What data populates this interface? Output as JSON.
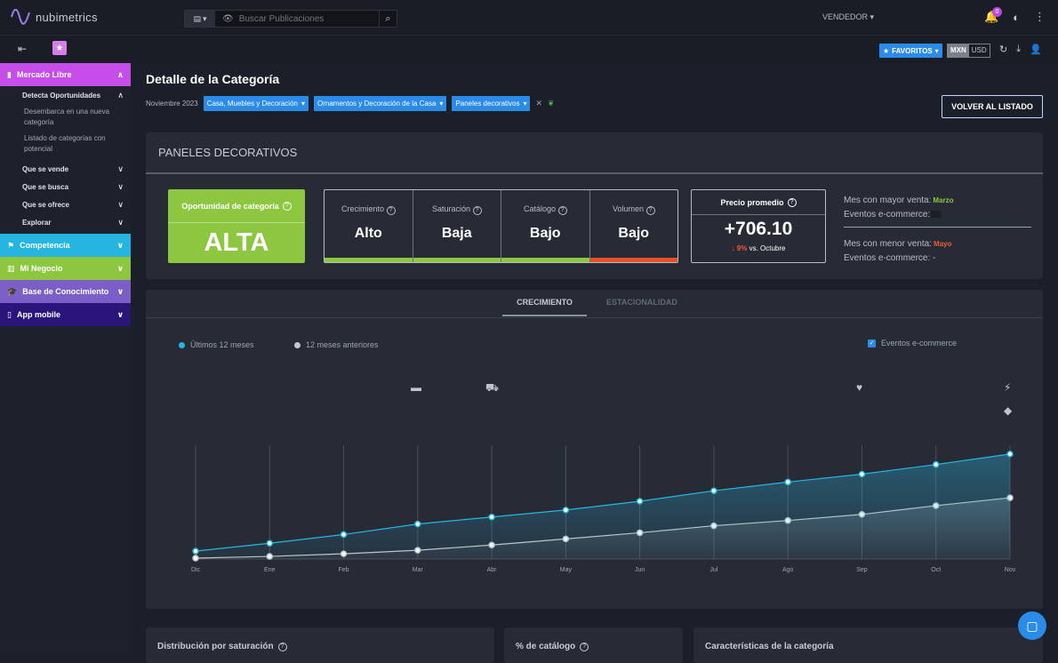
{
  "app": {
    "logo_text": "nubimetrics"
  },
  "search": {
    "placeholder": "Buscar Publicaciones"
  },
  "header": {
    "vendedor": "VENDEDOR",
    "notif_count": "0"
  },
  "toolbar": {
    "favoritos": "FAVORITOS",
    "currency_selected": "MXN",
    "currency_other": "USD"
  },
  "sidebar": {
    "mercado_libre": "Mercado Libre",
    "detecta": "Detecta Oportunidades",
    "desembarca": "Desembarca en una nueva categoría",
    "listado": "Listado de categorías con potencial",
    "que_vende": "Que se vende",
    "que_busca": "Que se busca",
    "que_ofrece": "Que se ofrece",
    "explorar": "Explorar",
    "competencia": "Competencia",
    "mi_negocio": "Mi Negocio",
    "base": "Base de Conocimiento",
    "app_mobile": "App mobile"
  },
  "page": {
    "title": "Detalle de la Categoría",
    "date": "Noviembre 2023",
    "crumbs": [
      "Casa, Muebles y Decoración",
      "Ornamentos y Decoración de la Casa",
      "Paneles decorativos"
    ],
    "volver": "VOLVER AL LISTADO"
  },
  "summary": {
    "heading": "PANELES DECORATIVOS",
    "oportunidad_label": "Oportunidad de categoría",
    "oportunidad_value": "ALTA",
    "metrics": [
      {
        "label": "Crecimiento",
        "value": "Alto",
        "color": "#8dc63f"
      },
      {
        "label": "Saturación",
        "value": "Baja",
        "color": "#8dc63f"
      },
      {
        "label": "Catálogo",
        "value": "Bajo",
        "color": "#8dc63f"
      },
      {
        "label": "Volumen",
        "value": "Bajo",
        "color": "#e8502a"
      }
    ],
    "precio_label": "Precio promedio",
    "precio_value": "+706.10",
    "precio_delta": "9%",
    "precio_vs": "vs. Octubre",
    "mayor_label": "Mes con mayor venta:",
    "mayor_value": "Marzo",
    "eventos1_label": "Eventos e-commerce:",
    "menor_label": "Mes con menor venta:",
    "menor_value": "Mayo",
    "eventos2_label": "Eventos e-commerce: -"
  },
  "chart_tabs": {
    "active": "CRECIMIENTO",
    "inactive": "ESTACIONALIDAD"
  },
  "chart_data": {
    "type": "area",
    "categories": [
      "Dic",
      "Ene",
      "Feb",
      "Mar",
      "Abr",
      "May",
      "Jun",
      "Jul",
      "Ago",
      "Sep",
      "Oct",
      "Nov"
    ],
    "series": [
      {
        "name": "Últimos 12 meses",
        "color": "#26b7e3",
        "values": [
          9,
          18,
          28,
          40,
          48,
          56,
          66,
          78,
          88,
          97,
          108,
          120
        ]
      },
      {
        "name": "12 meses anteriores",
        "color": "#c8c8c8",
        "values": [
          1,
          3,
          6,
          10,
          16,
          23,
          30,
          38,
          44,
          51,
          61,
          70
        ]
      }
    ],
    "ylim": [
      0,
      130
    ],
    "events_label": "Eventos e-commerce"
  },
  "bottom": {
    "dist": "Distribución por saturación",
    "catalogo": "% de catálogo",
    "caract": "Características de la categoría"
  }
}
